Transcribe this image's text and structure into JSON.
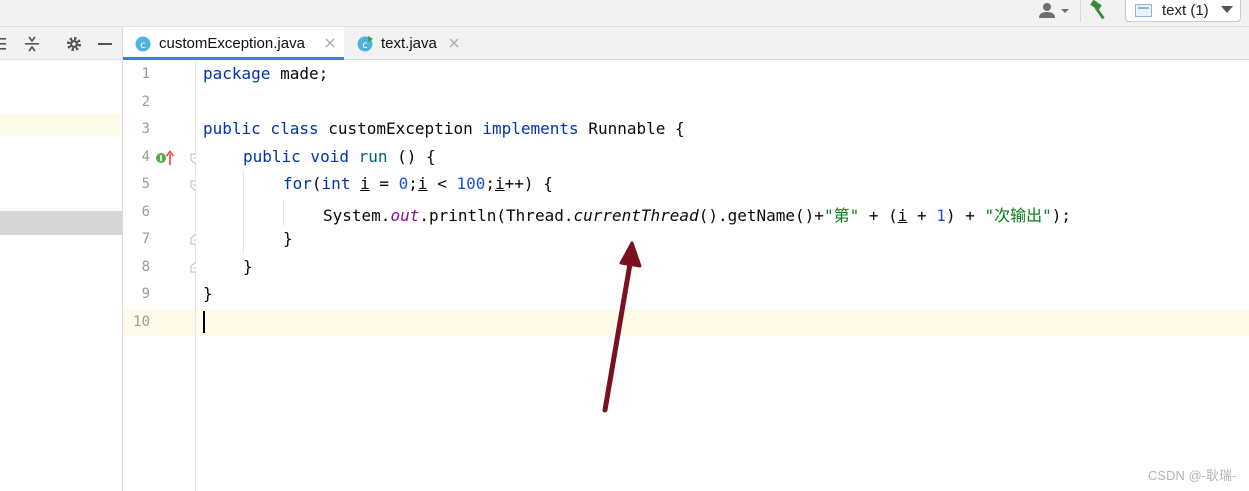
{
  "toolbar": {
    "run_config_label": "text (1)",
    "icons": [
      "user-icon",
      "chevron-down-icon",
      "hammer-icon",
      "run-config-icon"
    ]
  },
  "project_panel": {
    "icons": [
      "collapse-icon",
      "expand-icon",
      "gear-icon",
      "minimize-icon"
    ]
  },
  "tabs": [
    {
      "label": "customException.java",
      "active": true,
      "icon": "java-class-icon"
    },
    {
      "label": "text.java",
      "active": false,
      "icon": "java-runnable-class-icon"
    }
  ],
  "editor": {
    "line_numbers": [
      "1",
      "2",
      "3",
      "4",
      "5",
      "6",
      "7",
      "8",
      "9",
      "10"
    ],
    "current_line": "10",
    "lines": {
      "l1": {
        "kw": "package",
        "rest": " made;"
      },
      "l3": {
        "kw1": "public",
        "kw2": " class",
        "name": " customException",
        "kw3": " implements",
        "iface": " Runnable {"
      },
      "l4": {
        "kw1": "public",
        "kw2": " void",
        "fn": " run",
        "rest": " () {"
      },
      "l5": {
        "kw": "for",
        "p1": "(",
        "kw2": "int",
        "sp": " ",
        "v1": "i",
        "p2": " = ",
        "n1": "0",
        "p3": ";",
        "v2": "i",
        "p4": " < ",
        "n2": "100",
        "p5": ";",
        "v3": "i",
        "p6": "++) {"
      },
      "l6": {
        "a": "System.",
        "out": "out",
        "b": ".println(Thread.",
        "ct": "currentThread",
        "c": "().getName()+",
        "s1": "\"第\"",
        "d": " + (",
        "v": "i",
        "e": " + ",
        "n": "1",
        "f": ") + ",
        "s2": "\"次输出\"",
        "g": ");"
      },
      "l7": {
        "text": "}"
      },
      "l8": {
        "text": "}"
      },
      "l9": {
        "text": "}"
      }
    }
  },
  "annotation": {
    "color": "#7b1020"
  },
  "watermark": "CSDN @-耿瑞-"
}
